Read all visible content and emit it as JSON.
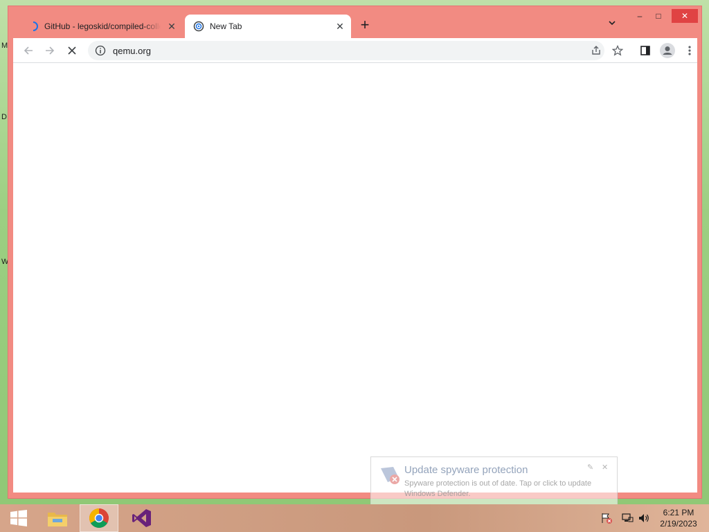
{
  "desktop": {
    "letters": [
      "M",
      "D",
      "W"
    ]
  },
  "window": {
    "tabs": [
      {
        "title": "GitHub - legoskid/compiled-collection",
        "active": false
      },
      {
        "title": "New Tab",
        "active": true
      }
    ],
    "new_tab_label": "+",
    "controls": {
      "minimize": "–",
      "maximize": "□",
      "close": "✕"
    }
  },
  "toolbar": {
    "address": "qemu.org",
    "loading": true
  },
  "notification": {
    "title": "Update spyware protection",
    "body": "Spyware protection is out of date. Tap or click to update Windows Defender."
  },
  "taskbar": {
    "clock_time": "6:21 PM",
    "clock_date": "2/19/2023",
    "pinned": [
      "start-button",
      "file-explorer",
      "chrome",
      "visual-studio"
    ]
  },
  "colors": {
    "window_frame": "#f28b82",
    "close_button": "#e04343",
    "taskbar": "#d6a58a"
  }
}
